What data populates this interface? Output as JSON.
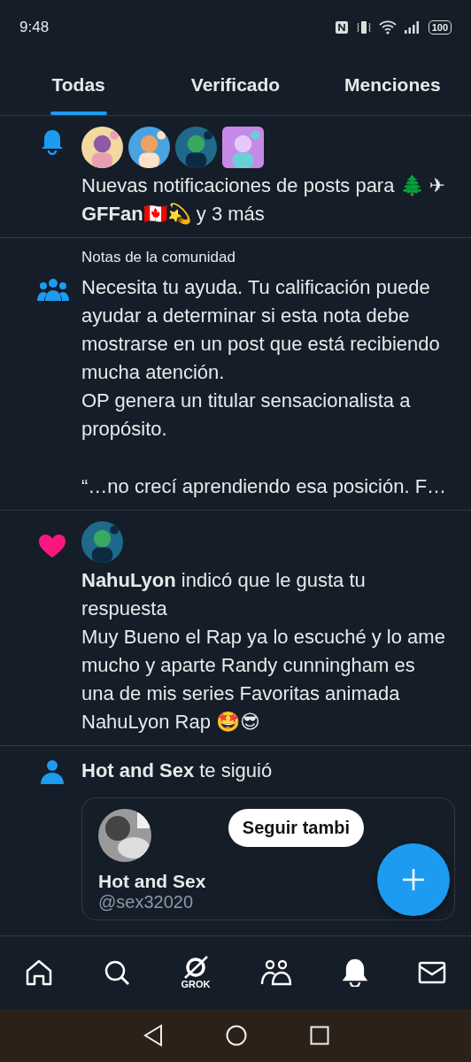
{
  "status_bar": {
    "time": "9:48",
    "battery": "100"
  },
  "tabs": [
    {
      "label": "Todas",
      "selected": true
    },
    {
      "label": "Verificado",
      "selected": false
    },
    {
      "label": "Menciones",
      "selected": false
    }
  ],
  "notifications": [
    {
      "kind": "posts",
      "text": "Nuevas notificaciones de posts para 🌲 **✈GFFan🇨🇦💫** y 3 más"
    },
    {
      "kind": "community_note",
      "label": "Notas de la comunidad",
      "paragraphs": [
        "Necesita tu ayuda. Tu calificación puede ayudar a determinar si esta nota debe mostrarse en un post que está recibiendo mucha atención.",
        "OP genera un titular sensacionalista a propósito."
      ],
      "quote": "“…no crecí aprendiendo esa posición. F…"
    },
    {
      "kind": "like",
      "text": "**NahuLyon** indicó que le gusta tu respuesta",
      "body": "Muy Bueno el Rap ya lo escuché y lo ame mucho y aparte Randy cunningham es una de mis series Favoritas animada NahuLyon Rap 🤩😎"
    },
    {
      "kind": "follow",
      "text": "**Hot and Sex** te siguió",
      "card": {
        "name": "Hot and Sex",
        "handle": "@sex32020",
        "button": "Seguir tambi"
      }
    }
  ],
  "bottom_nav": [
    {
      "kind": "home",
      "selected": false
    },
    {
      "kind": "search",
      "selected": false
    },
    {
      "kind": "grok",
      "label": "GROK",
      "selected": false
    },
    {
      "kind": "communities",
      "selected": false
    },
    {
      "kind": "notifications",
      "selected": true
    },
    {
      "kind": "messages",
      "selected": false
    }
  ]
}
